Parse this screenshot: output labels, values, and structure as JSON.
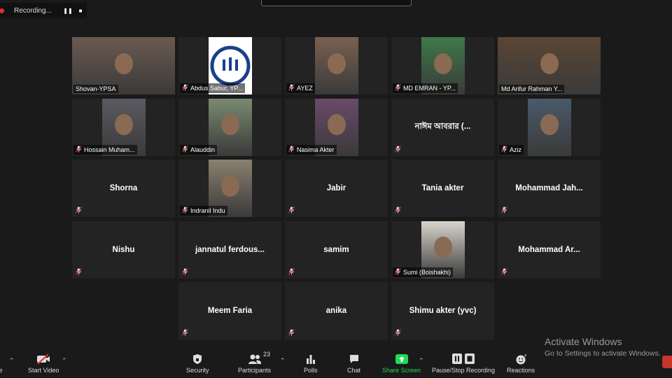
{
  "recording": {
    "label": "Recording...",
    "pause_icon": "pause-icon",
    "stop_icon": "stop-icon"
  },
  "tiles": [
    {
      "display": "Shovan-YPSA",
      "label": "Shovan-YPSA",
      "muted": false,
      "video": true,
      "bg": "#6b5a50"
    },
    {
      "display": "Abdus Sabur, YP...",
      "label": "Abdus Sabur, YP...",
      "muted": true,
      "video": true,
      "logo": "ypsa-logo"
    },
    {
      "display": "AYEZ",
      "label": "AYEZ",
      "muted": true,
      "video": true,
      "bg": "#7a6050"
    },
    {
      "display": "MD EMRAN - YP...",
      "label": "MD EMRAN - YP...",
      "muted": true,
      "video": true,
      "bg": "#3d7a48"
    },
    {
      "display": "Md Arifur Rahman Y...",
      "label": "Md Arifur Rahman Y...",
      "muted": false,
      "video": true,
      "speaker": true,
      "bg": "#5a4634"
    },
    {
      "display": "Hossain Muham...",
      "label": "Hossain Muham...",
      "muted": true,
      "video": true,
      "bg": "#5a5a62"
    },
    {
      "display": "Alauddin",
      "label": "Alauddin",
      "muted": true,
      "video": true,
      "bg": "#7a8a70"
    },
    {
      "display": "Nasima Akter",
      "label": "Nasima Akter",
      "muted": true,
      "video": true,
      "bg": "#6a4a6a"
    },
    {
      "display": "নাঈম আবরার (...",
      "label": "",
      "muted": true,
      "video": false
    },
    {
      "display": "Aziz",
      "label": "Aziz",
      "muted": true,
      "video": true,
      "bg": "#4a5a6a"
    },
    {
      "display": "Shorna",
      "label": "",
      "muted": true,
      "video": false
    },
    {
      "display": "Indranil Indu",
      "label": "Indranil Indu",
      "muted": true,
      "video": true,
      "bg": "#8a8070"
    },
    {
      "display": "Jabir",
      "label": "",
      "muted": true,
      "video": false
    },
    {
      "display": "Tania akter",
      "label": "",
      "muted": true,
      "video": false
    },
    {
      "display": "Mohammad Jah...",
      "label": "",
      "muted": true,
      "video": false
    },
    {
      "display": "Nishu",
      "label": "",
      "muted": true,
      "video": false
    },
    {
      "display": "jannatul ferdous...",
      "label": "",
      "muted": true,
      "video": false
    },
    {
      "display": "samim",
      "label": "",
      "muted": true,
      "video": false
    },
    {
      "display": "Sumi (Boishakhi)",
      "label": "Sumi (Boishakhi)",
      "muted": true,
      "video": true,
      "bg": "#d8d4cc"
    },
    {
      "display": "Mohammad Ar...",
      "label": "",
      "muted": true,
      "video": false
    },
    {
      "display": "Meem Faria",
      "label": "",
      "muted": true,
      "video": false
    },
    {
      "display": "anika",
      "label": "",
      "muted": true,
      "video": false
    },
    {
      "display": "Shimu akter (yvc)",
      "label": "",
      "muted": true,
      "video": false
    }
  ],
  "toolbar": {
    "mute_label": "te",
    "start_video_label": "Start Video",
    "security_label": "Security",
    "participants_label": "Participants",
    "participants_count": "23",
    "polls_label": "Polls",
    "chat_label": "Chat",
    "share_screen_label": "Share Screen",
    "recording_label": "Pause/Stop Recording",
    "reactions_label": "Reactions",
    "share_color": "#23d959"
  },
  "watermark": {
    "title": "Activate Windows",
    "subtitle": "Go to Settings to activate Windows."
  }
}
